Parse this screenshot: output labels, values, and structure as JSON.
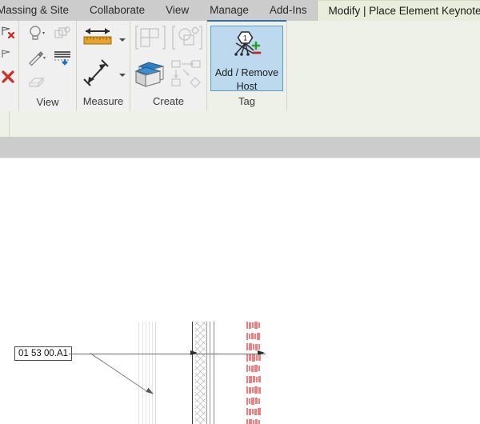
{
  "tabs": [
    {
      "label": "Massing & Site",
      "active": false,
      "name": "tab-massing-site"
    },
    {
      "label": "Collaborate",
      "active": false,
      "name": "tab-collaborate"
    },
    {
      "label": "View",
      "active": false,
      "name": "tab-view"
    },
    {
      "label": "Manage",
      "active": false,
      "name": "tab-manage"
    },
    {
      "label": "Add-Ins",
      "active": false,
      "name": "tab-add-ins"
    },
    {
      "label": "Modify | Place Element Keynote",
      "active": true,
      "name": "tab-modify-place-element-keynote"
    }
  ],
  "ribbon": {
    "panels": [
      {
        "label": "",
        "name": "panel-modify"
      },
      {
        "label": "View",
        "name": "panel-view"
      },
      {
        "label": "Measure",
        "name": "panel-measure"
      },
      {
        "label": "Create",
        "name": "panel-create"
      },
      {
        "label": "Tag",
        "name": "panel-tag"
      }
    ],
    "tag_panel": {
      "button_label_line1": "Add / Remove",
      "button_label_line2": "Host",
      "button_badge": "1"
    }
  },
  "canvas": {
    "keynote_tag_value": "01 53 00.A1"
  },
  "colors": {
    "tab_strip_bg": "#cccccc",
    "ribbon_green": "#eef1e7",
    "active_tab_bg": "#e8eedb",
    "panel_gray": "#f0f0f0",
    "selected_button_bg": "#bcd9ee",
    "selected_button_border": "#5d9cc9",
    "accent_blue": "#2a72b5",
    "options_bar": "#cccccc",
    "keynote_red": "#f08080",
    "canvas_bg": "#ffffff"
  }
}
